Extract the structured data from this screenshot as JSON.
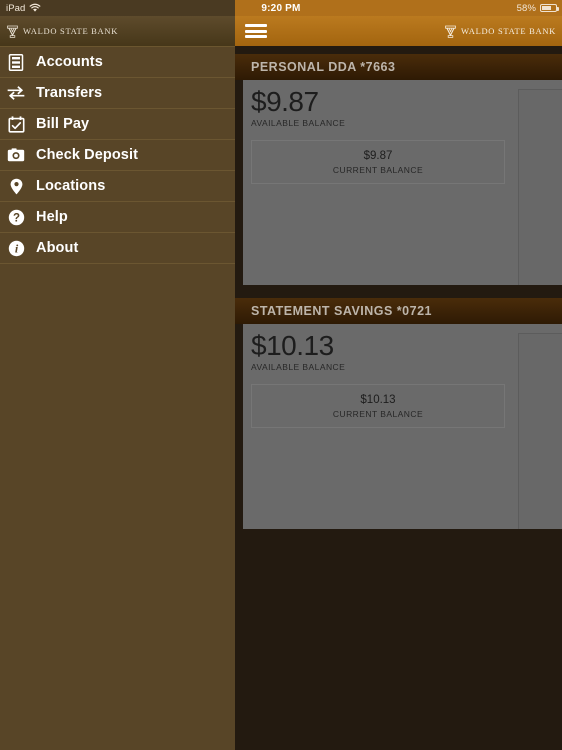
{
  "status_bar": {
    "device_label": "iPad",
    "wifi_icon": "wifi-icon",
    "time": "9:20 PM",
    "battery_percent": "58%",
    "battery_icon": "battery-icon"
  },
  "brand": {
    "name": "WALDO STATE BANK",
    "crest_icon": "bank-crest-icon"
  },
  "sidebar": {
    "items": [
      {
        "label": "Accounts",
        "icon": "filing-cabinet-icon"
      },
      {
        "label": "Transfers",
        "icon": "transfer-arrows-icon"
      },
      {
        "label": "Bill Pay",
        "icon": "calendar-check-icon"
      },
      {
        "label": "Check Deposit",
        "icon": "camera-icon"
      },
      {
        "label": "Locations",
        "icon": "map-pin-icon"
      },
      {
        "label": "Help",
        "icon": "question-circle-icon"
      },
      {
        "label": "About",
        "icon": "info-circle-icon"
      }
    ]
  },
  "topbar": {
    "menu_icon": "hamburger-menu-icon"
  },
  "accounts": [
    {
      "title": "PERSONAL DDA *7663",
      "available_balance": "$9.87",
      "available_label": "AVAILABLE BALANCE",
      "current_balance": "$9.87",
      "current_label": "CURRENT BALANCE"
    },
    {
      "title": "STATEMENT SAVINGS *0721",
      "available_balance": "$10.13",
      "available_label": "AVAILABLE BALANCE",
      "current_balance": "$10.13",
      "current_label": "CURRENT BALANCE"
    }
  ],
  "colors": {
    "sidebar_bg": "#584527",
    "accent_orange": "#b0701b",
    "card_header": "#3a2207",
    "page_bg": "#231a10",
    "panel_gray": "#6a6a6a"
  }
}
